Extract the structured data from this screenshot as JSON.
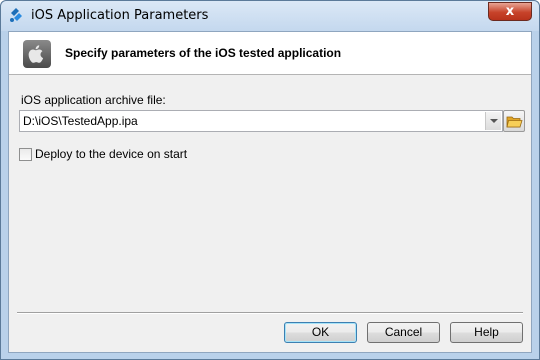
{
  "window": {
    "title": "iOS Application Parameters",
    "close_label": "x"
  },
  "header": {
    "title": "Specify parameters of the iOS tested application",
    "icon": "apple-icon"
  },
  "form": {
    "archive_label": "iOS application archive file:",
    "archive_value": "D:\\iOS\\TestedApp.ipa",
    "browse_icon": "folder-icon",
    "deploy_label": "Deploy to the device on start",
    "deploy_checked": false
  },
  "buttons": {
    "ok": "OK",
    "cancel": "Cancel",
    "help": "Help"
  },
  "colors": {
    "default_button_border": "#3c7fb1",
    "close_button": "#c7432a",
    "client_background": "#f0f0f0"
  }
}
